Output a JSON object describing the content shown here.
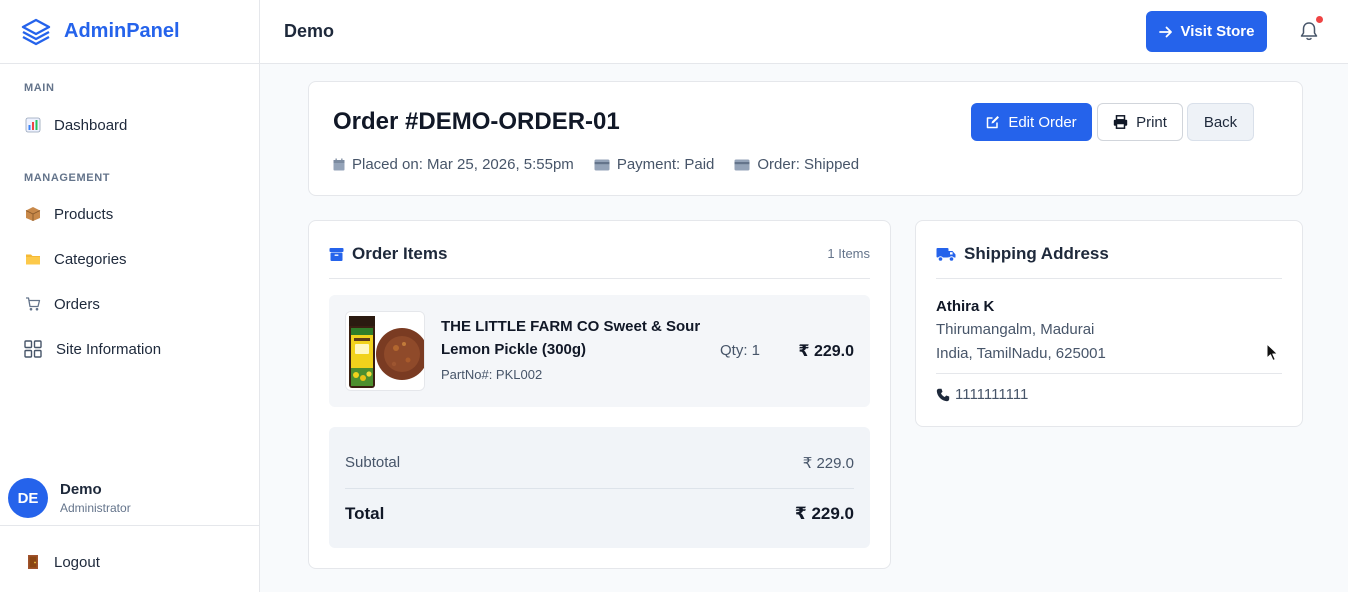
{
  "brand": {
    "name": "AdminPanel",
    "color": "#2563eb"
  },
  "sidebar": {
    "sections": [
      {
        "label": "MAIN"
      },
      {
        "label": "MANAGEMENT"
      }
    ],
    "items": [
      {
        "label": "Dashboard",
        "icon": "bar-chart-icon"
      },
      {
        "label": "Products",
        "icon": "package-icon"
      },
      {
        "label": "Categories",
        "icon": "folder-icon"
      },
      {
        "label": "Orders",
        "icon": "cart-icon"
      },
      {
        "label": "Site Information",
        "icon": "grid-icon"
      }
    ],
    "user": {
      "initials": "DE",
      "name": "Demo",
      "role": "Administrator"
    },
    "logout_label": "Logout"
  },
  "header": {
    "title": "Demo",
    "visit_store_label": "Visit Store",
    "notification_dot_color": "#ef4444"
  },
  "order": {
    "title": "Order #DEMO-ORDER-01",
    "placed_on": "Placed on: Mar 25, 2026, 5:55pm",
    "payment": "Payment: Paid",
    "status": "Order: Shipped",
    "edit_label": "Edit Order",
    "print_label": "Print",
    "back_label": "Back"
  },
  "items_card": {
    "title": "Order Items",
    "count": "1 Items",
    "items": [
      {
        "name": "THE LITTLE FARM CO Sweet & Sour Lemon Pickle (300g)",
        "part": "PartNo#: PKL002",
        "qty": "Qty: 1",
        "price": "₹ 229.0"
      }
    ],
    "subtotal_label": "Subtotal",
    "subtotal_value": "₹ 229.0",
    "total_label": "Total",
    "total_value": "₹ 229.0"
  },
  "shipping": {
    "title": "Shipping Address",
    "name": "Athira K",
    "line1": "Thirumangalm, Madurai",
    "line2": "India, TamilNadu, 625001",
    "phone": "1111111111"
  }
}
